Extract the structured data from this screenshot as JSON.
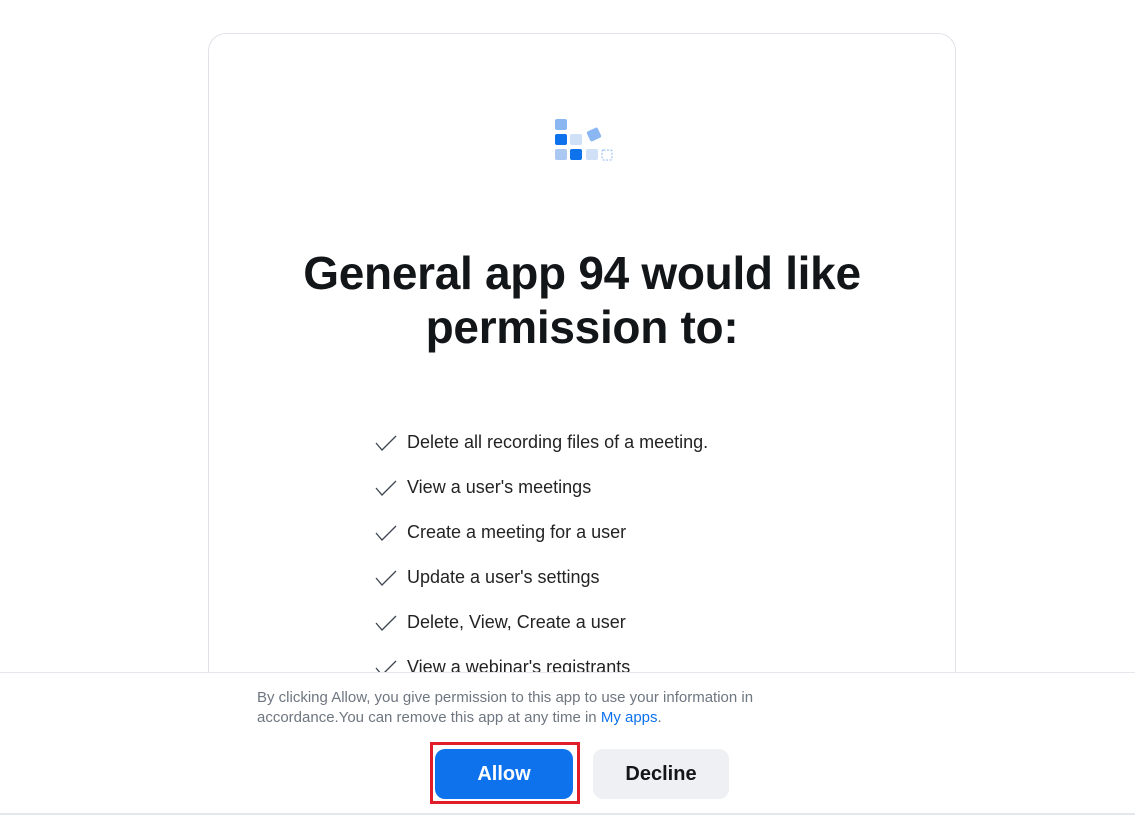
{
  "app": {
    "logo_icon": "app-tiles-icon"
  },
  "title": "General app 94 would like permission to:",
  "permissions": [
    "Delete all recording files of a meeting.",
    "View a user's meetings",
    "Create a meeting for a user",
    "Update a user's settings",
    "Delete, View, Create a user",
    "View a webinar's registrants"
  ],
  "footer": {
    "disclaimer_prefix": "By clicking Allow, you give permission to this app to use your information in accordance.You can remove this app at any time in ",
    "my_apps_link": "My apps",
    "disclaimer_suffix": ".",
    "allow_label": "Allow",
    "decline_label": "Decline"
  },
  "colors": {
    "accent": "#0e72ed",
    "highlight": "#e21d2a",
    "decline_bg": "#eef0f3"
  }
}
